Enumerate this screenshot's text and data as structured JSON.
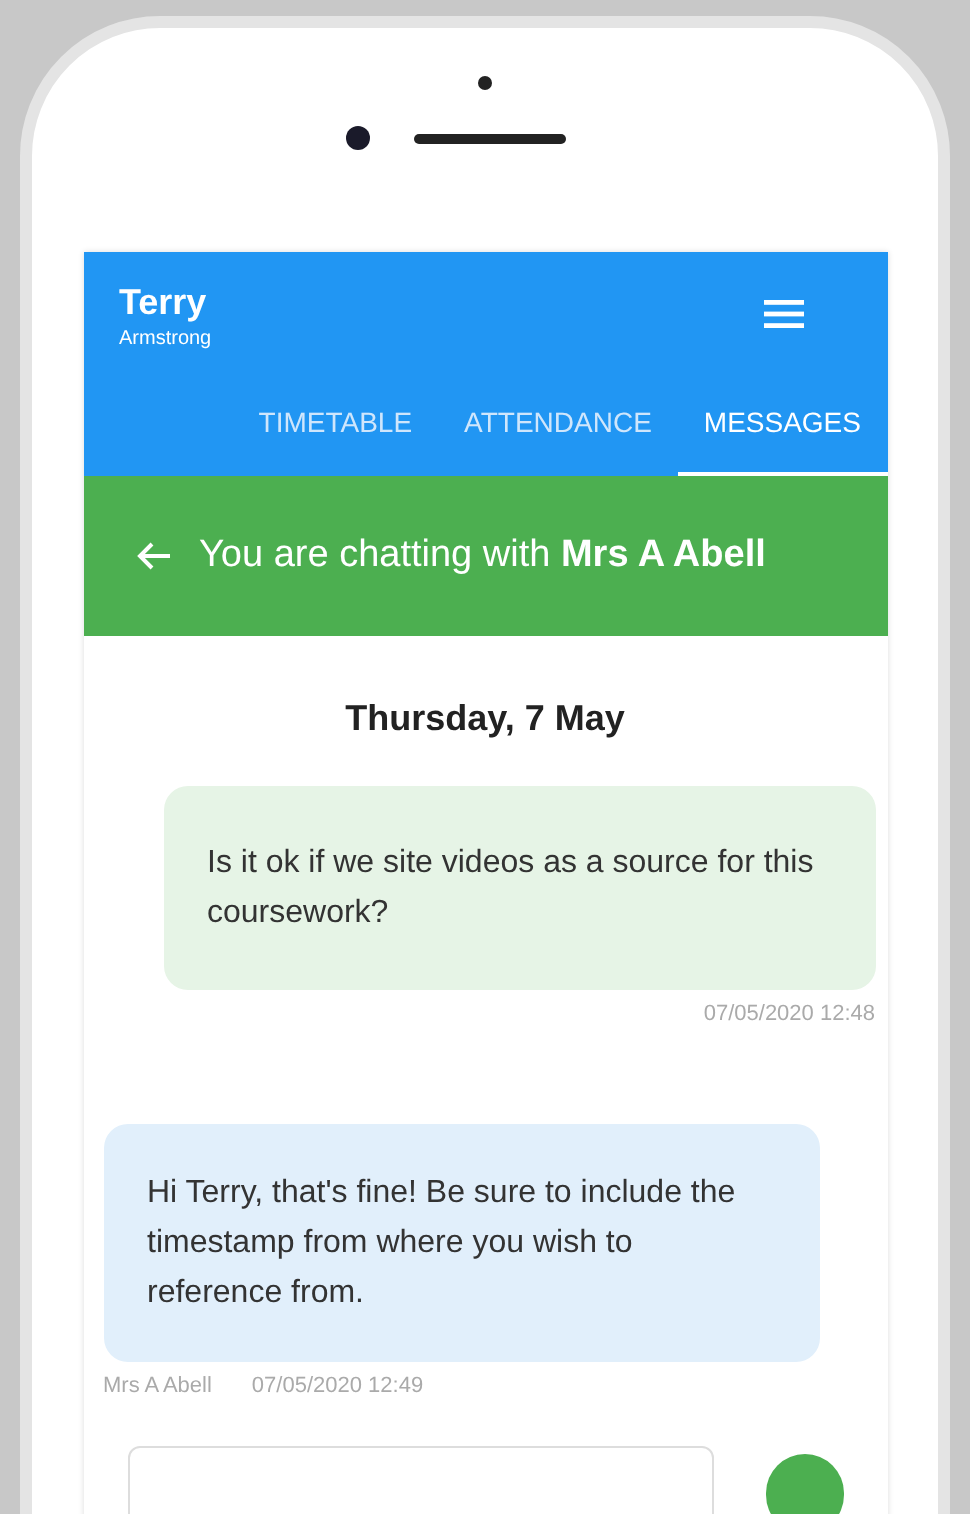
{
  "header": {
    "name": "Terry",
    "subtitle": "Armstrong"
  },
  "tabs": [
    {
      "label": "TIMETABLE",
      "selected": false
    },
    {
      "label": "ATTENDANCE",
      "selected": false
    },
    {
      "label": "MESSAGES",
      "selected": true
    }
  ],
  "chat_bar": {
    "title": "You are chatting with **Mrs A Abell**"
  },
  "date": "Thursday, 7 May",
  "messages": [
    {
      "kind": "sent",
      "text": "Is it ok if we site videos as a source for this coursework?",
      "time": "07/05/2020 12:48"
    },
    {
      "kind": "received",
      "text": "Hi Terry, that's fine! Be sure to include the timestamp from where you wish to reference from.",
      "sender": "Mrs A Abell",
      "time": "07/05/2020 12:49"
    }
  ]
}
